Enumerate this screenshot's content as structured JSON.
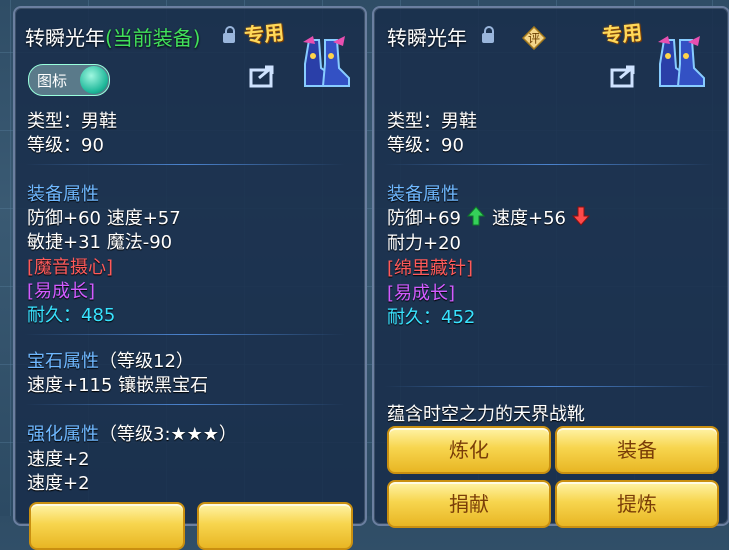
{
  "left_panel": {
    "title": "转瞬光年",
    "status": "(当前装备)",
    "special_tag": "专用",
    "icon_toggle_label": "图标",
    "type": "类型：男鞋",
    "level": "等级：90",
    "equip_attr_heading": "装备属性",
    "attr_line1": "防御+60 速度+57",
    "attr_line2": "敏捷+31 魔法-90",
    "special_skill": "[魔音摄心]",
    "special_effect": "[易成长]",
    "durability_label": "耐久：",
    "durability_value": "485",
    "gem_heading": "宝石属性",
    "gem_level": "（等级12）",
    "gem_line": "速度+115 镶嵌黑宝石",
    "enhance_heading": "强化属性",
    "enhance_level": "（等级3:★★★）",
    "enhance_line1": "速度+2",
    "enhance_line2": "速度+2"
  },
  "right_panel": {
    "title": "转瞬光年",
    "appraise_badge": "评",
    "special_tag": "专用",
    "type": "类型：男鞋",
    "level": "等级：90",
    "equip_attr_heading": "装备属性",
    "defense": "防御+69",
    "speed": "速度+56",
    "attr_line2": "耐力+20",
    "special_skill": "[绵里藏针]",
    "special_effect": "[易成长]",
    "durability_label": "耐久：",
    "durability_value": "452",
    "description": "蕴含时空之力的天界战靴",
    "buttons": {
      "refine": "炼化",
      "equip": "装备",
      "donate": "捐献",
      "extract": "提炼"
    }
  },
  "colors": {
    "section": "#6fb8ff",
    "equipped": "#41e05a",
    "skill": "#ff5a5a",
    "effect": "#d25cff",
    "durability": "#39e3ff",
    "up": "#35d05a",
    "down": "#ff4a4a"
  },
  "icons": [
    "lock-icon",
    "share-icon",
    "boots-icon",
    "appraise-icon",
    "arrow-up-icon",
    "arrow-down-icon"
  ]
}
